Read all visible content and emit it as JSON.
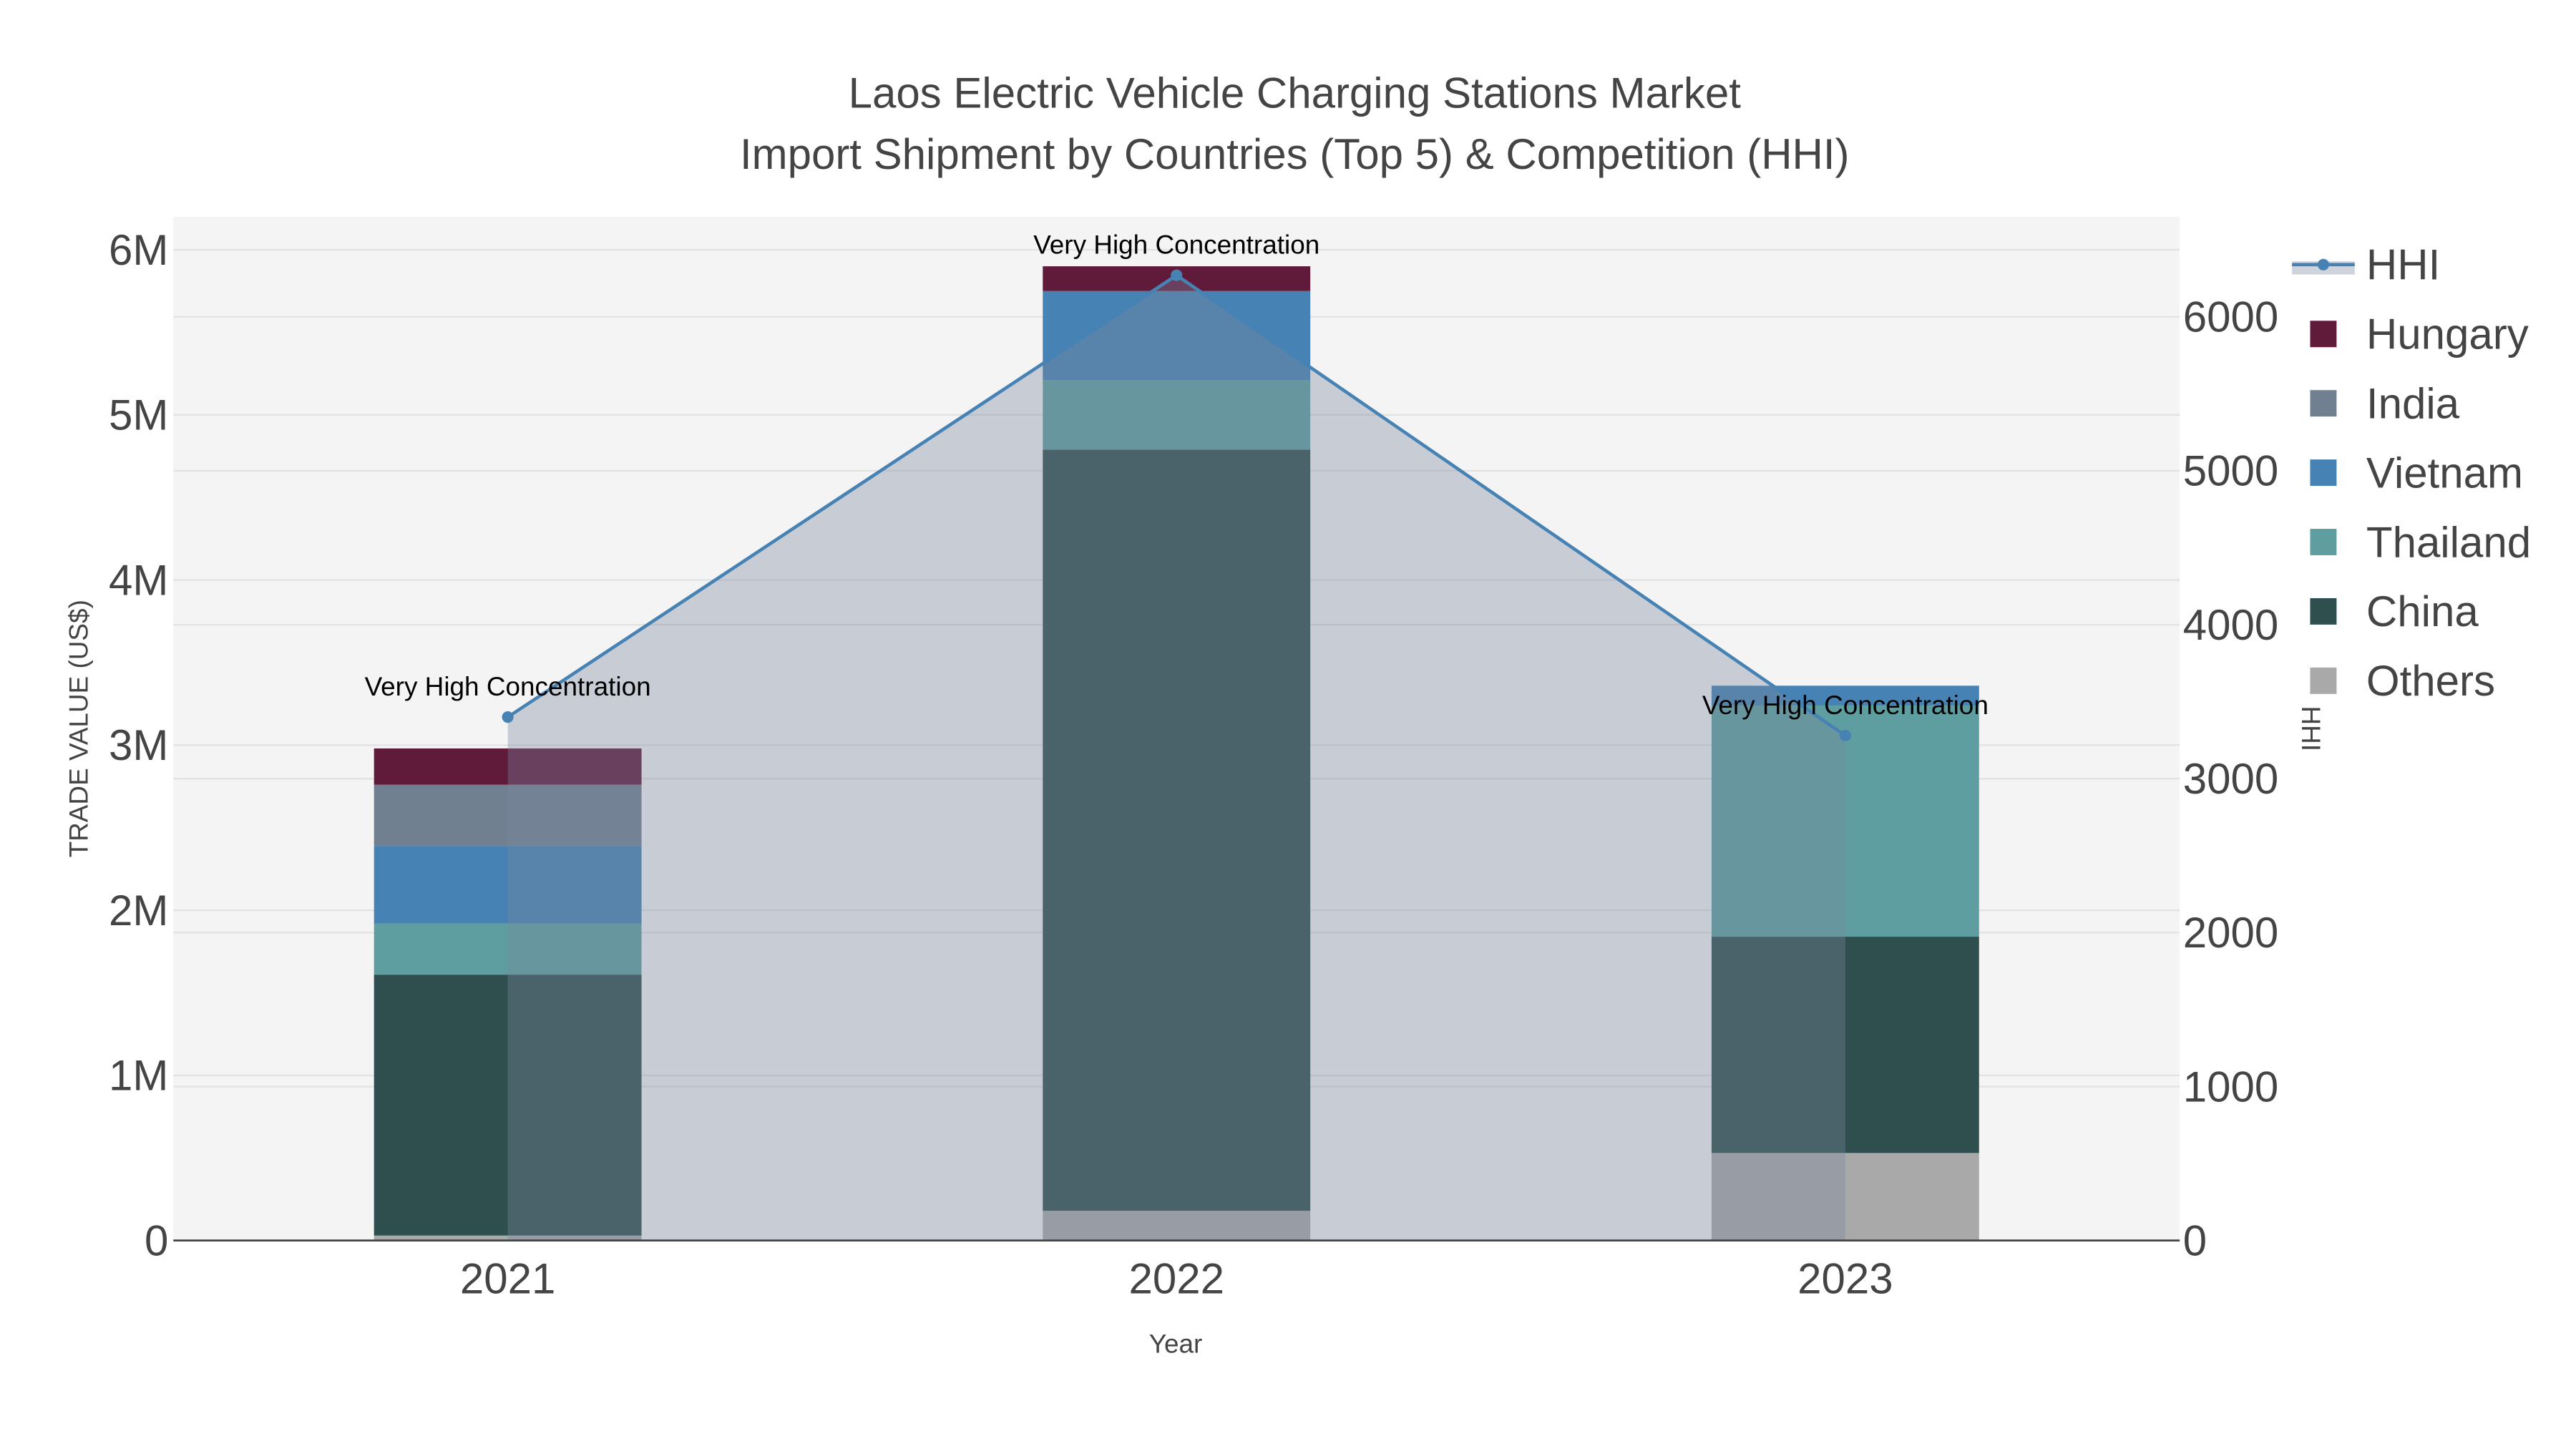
{
  "chart_data": {
    "type": "bar",
    "stacked": true,
    "title": "Laos Electric Vehicle Charging Stations Market",
    "subtitle": "Import Shipment by Countries (Top 5) & Competition (HHI)",
    "xlabel": "Year",
    "ylabel": "TRADE VALUE (US$)",
    "y2label": "HHI",
    "categories": [
      "2021",
      "2022",
      "2023"
    ],
    "ylim": [
      0,
      6200000
    ],
    "y2lim": [
      0,
      6650
    ],
    "yticks": [
      {
        "v": 0,
        "label": "0"
      },
      {
        "v": 1000000,
        "label": "1M"
      },
      {
        "v": 2000000,
        "label": "2M"
      },
      {
        "v": 3000000,
        "label": "3M"
      },
      {
        "v": 4000000,
        "label": "4M"
      },
      {
        "v": 5000000,
        "label": "5M"
      },
      {
        "v": 6000000,
        "label": "6M"
      }
    ],
    "y2ticks": [
      {
        "v": 0,
        "label": "0"
      },
      {
        "v": 1000,
        "label": "1000"
      },
      {
        "v": 2000,
        "label": "2000"
      },
      {
        "v": 3000,
        "label": "3000"
      },
      {
        "v": 4000,
        "label": "4000"
      },
      {
        "v": 5000,
        "label": "5000"
      },
      {
        "v": 6000,
        "label": "6000"
      }
    ],
    "series": [
      {
        "name": "Others",
        "color": "#a9a9a9",
        "values": [
          30000,
          180000,
          530000
        ]
      },
      {
        "name": "China",
        "color": "#2f4f4f",
        "values": [
          1580000,
          4610000,
          1310000
        ]
      },
      {
        "name": "Thailand",
        "color": "#5f9ea0",
        "values": [
          310000,
          420000,
          1400000
        ]
      },
      {
        "name": "Vietnam",
        "color": "#4682b4",
        "values": [
          470000,
          540000,
          120000
        ]
      },
      {
        "name": "India",
        "color": "#708090",
        "values": [
          370000,
          0,
          0
        ]
      },
      {
        "name": "Hungary",
        "color": "#601a3a",
        "values": [
          220000,
          150000,
          0
        ]
      }
    ],
    "hhi": {
      "name": "HHI",
      "color": "#4682b4",
      "values": [
        3400,
        6270,
        3280
      ],
      "annotations": [
        "Very High Concentration",
        "Very High Concentration",
        "Very High Concentration"
      ]
    },
    "legend": [
      "HHI",
      "Hungary",
      "India",
      "Vietnam",
      "Thailand",
      "China",
      "Others"
    ],
    "legend_placement": "right",
    "grid": true
  }
}
